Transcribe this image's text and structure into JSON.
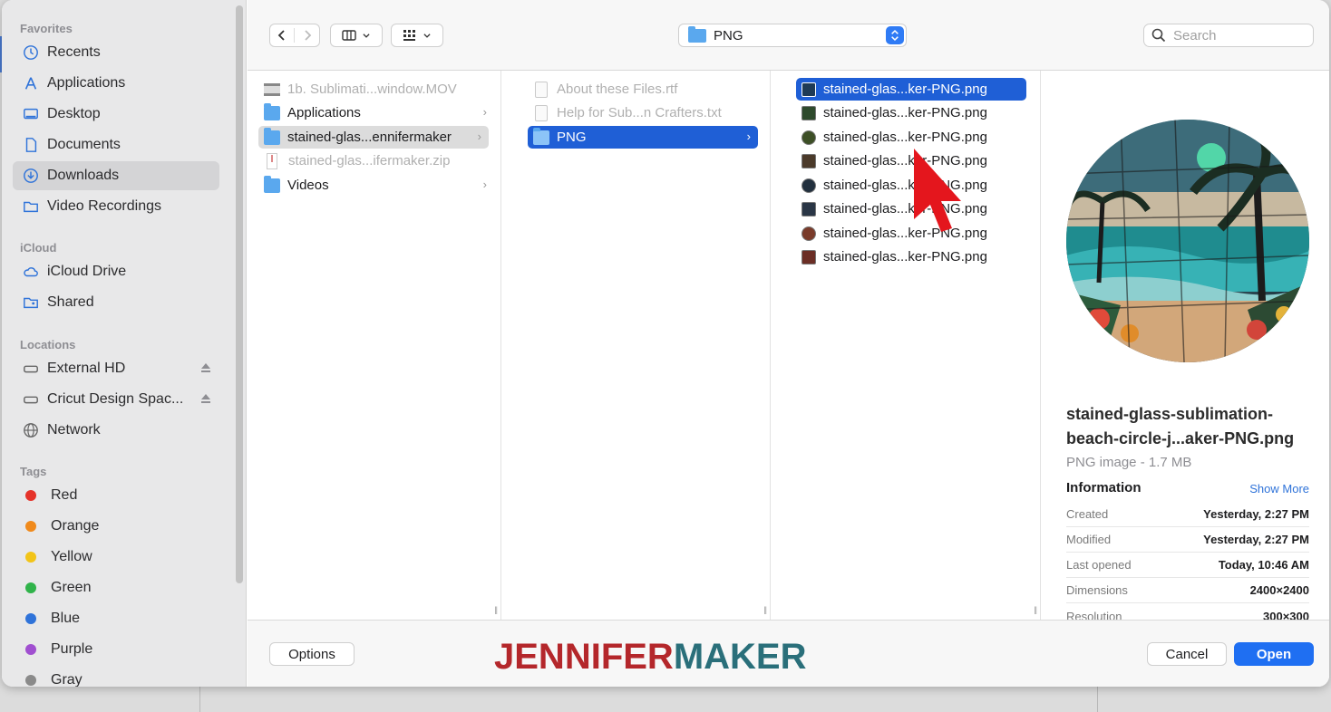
{
  "sidebar": {
    "sections": {
      "favorites": "Favorites",
      "icloud": "iCloud",
      "locations": "Locations",
      "tags": "Tags"
    },
    "favorites": [
      "Recents",
      "Applications",
      "Desktop",
      "Documents",
      "Downloads",
      "Video Recordings"
    ],
    "icloud": [
      "iCloud Drive",
      "Shared"
    ],
    "locations": [
      "External HD",
      "Cricut Design Spac...",
      "Network"
    ],
    "tags": [
      {
        "label": "Red",
        "color": "#e5332a"
      },
      {
        "label": "Orange",
        "color": "#f08a1c"
      },
      {
        "label": "Yellow",
        "color": "#f2c418"
      },
      {
        "label": "Green",
        "color": "#30b34a"
      },
      {
        "label": "Blue",
        "color": "#2f73d9"
      },
      {
        "label": "Purple",
        "color": "#a04fd0"
      },
      {
        "label": "Gray",
        "color": "#8a8a8a"
      }
    ],
    "selected": "Downloads"
  },
  "toolbar": {
    "path": "PNG",
    "search_placeholder": "Search"
  },
  "columns": {
    "col1": [
      {
        "label": "1b. Sublimati...window.MOV",
        "kind": "mov",
        "dim": true
      },
      {
        "label": "Applications",
        "kind": "folder",
        "chevron": true
      },
      {
        "label": "stained-glas...ennifermaker",
        "kind": "folder",
        "chevron": true,
        "selected": true
      },
      {
        "label": "stained-glas...ifermaker.zip",
        "kind": "zip",
        "dim": true
      },
      {
        "label": "Videos",
        "kind": "folder",
        "chevron": true
      }
    ],
    "col2": [
      {
        "label": "About these Files.rtf",
        "kind": "doc",
        "dim": true
      },
      {
        "label": "Help for Sub...n Crafters.txt",
        "kind": "doc",
        "dim": true
      },
      {
        "label": "PNG",
        "kind": "folder",
        "chevron": true,
        "selected": true
      }
    ],
    "col3": [
      {
        "label": "stained-glas...ker-PNG.png",
        "thumb": "#1f3b56"
      },
      {
        "label": "stained-glas...ker-PNG.png",
        "thumb": "#2e4a2c"
      },
      {
        "label": "stained-glas...ker-PNG.png",
        "thumb": "#3d4f26"
      },
      {
        "label": "stained-glas...ker-PNG.png",
        "thumb": "#4b3a2a"
      },
      {
        "label": "stained-glas...ker-PNG.png",
        "thumb": "#22303e"
      },
      {
        "label": "stained-glas...ker-PNG.png",
        "thumb": "#2a3646"
      },
      {
        "label": "stained-glas...ker-PNG.png",
        "thumb": "#7a3b2a"
      },
      {
        "label": "stained-glas...ker-PNG.png",
        "thumb": "#6b2e25"
      }
    ]
  },
  "preview": {
    "name": "stained-glass-sublimation-beach-circle-j...aker-PNG.png",
    "kind": "PNG image - 1.7 MB",
    "info_heading": "Information",
    "show_more": "Show More",
    "rows": [
      {
        "k": "Created",
        "v": "Yesterday, 2:27 PM"
      },
      {
        "k": "Modified",
        "v": "Yesterday, 2:27 PM"
      },
      {
        "k": "Last opened",
        "v": "Today, 10:46 AM"
      },
      {
        "k": "Dimensions",
        "v": "2400×2400"
      },
      {
        "k": "Resolution",
        "v": "300×300"
      }
    ]
  },
  "footer": {
    "options": "Options",
    "cancel": "Cancel",
    "open": "Open",
    "logo_part1": "JENNIFER",
    "logo_part2": "MAKER"
  }
}
